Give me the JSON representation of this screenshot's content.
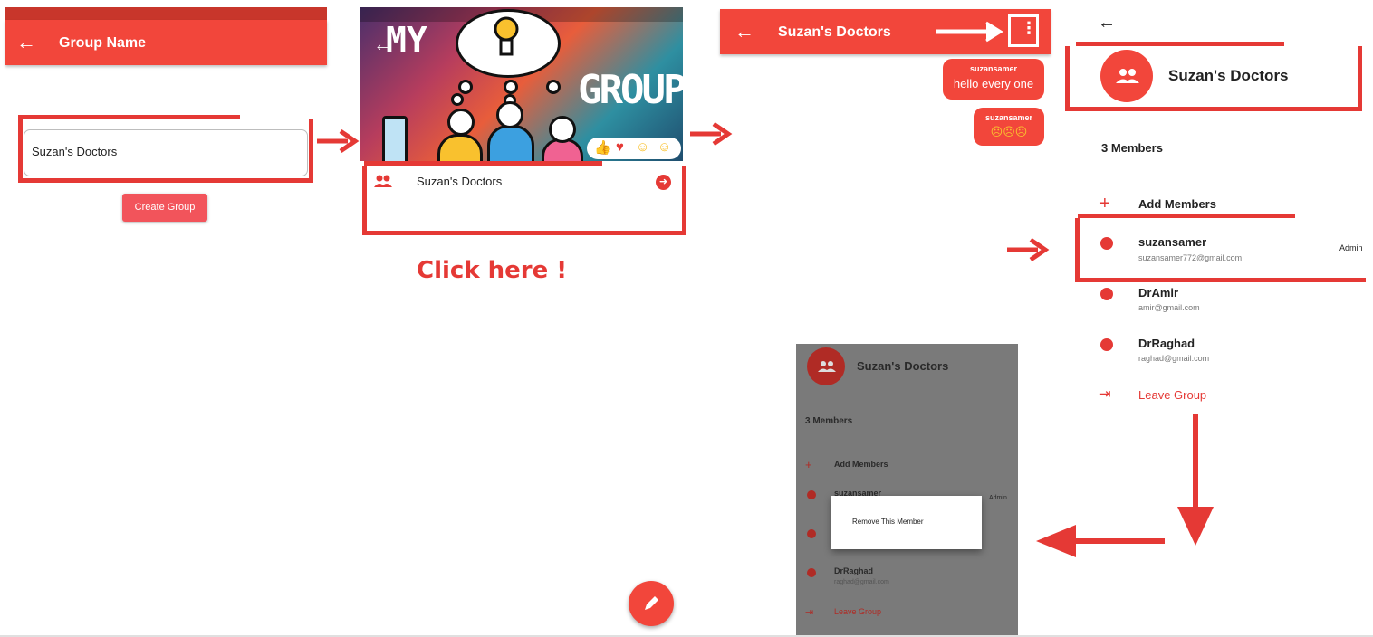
{
  "screen1": {
    "title": "Group Name",
    "input_value": "Suzan's Doctors",
    "create_button": "Create Group"
  },
  "screen2": {
    "banner_word_1": "MY",
    "banner_word_2": "GROUPS",
    "group_name": "Suzan's Doctors",
    "annotation": "Click here !"
  },
  "screen3": {
    "title": "Suzan's Doctors",
    "messages": [
      {
        "sender": "suzansamer",
        "text": "hello every one"
      },
      {
        "sender": "suzansamer",
        "text": "☹☹☹"
      }
    ]
  },
  "screen4": {
    "group_name": "Suzan's Doctors",
    "members_count": "3 Members",
    "add_members": "Add Members",
    "members": [
      {
        "name": "suzansamer",
        "email": "suzansamer772@gmail.com",
        "role": "Admin"
      },
      {
        "name": "DrAmir",
        "email": "amir@gmail.com"
      },
      {
        "name": "DrRaghad",
        "email": "raghad@gmail.com"
      }
    ],
    "leave_group": "Leave Group"
  },
  "screen5": {
    "group_name": "Suzan's Doctors",
    "members_count": "3 Members",
    "add_members": "Add Members",
    "partial_member": "suzansamer",
    "admin": "Admin",
    "member_3_name": "DrRaghad",
    "member_3_email": "raghad@gmail.com",
    "leave_group": "Leave Group",
    "dialog_option": "Remove This Member"
  },
  "colors": {
    "accent": "#f2463b",
    "annotation": "#e53935"
  }
}
